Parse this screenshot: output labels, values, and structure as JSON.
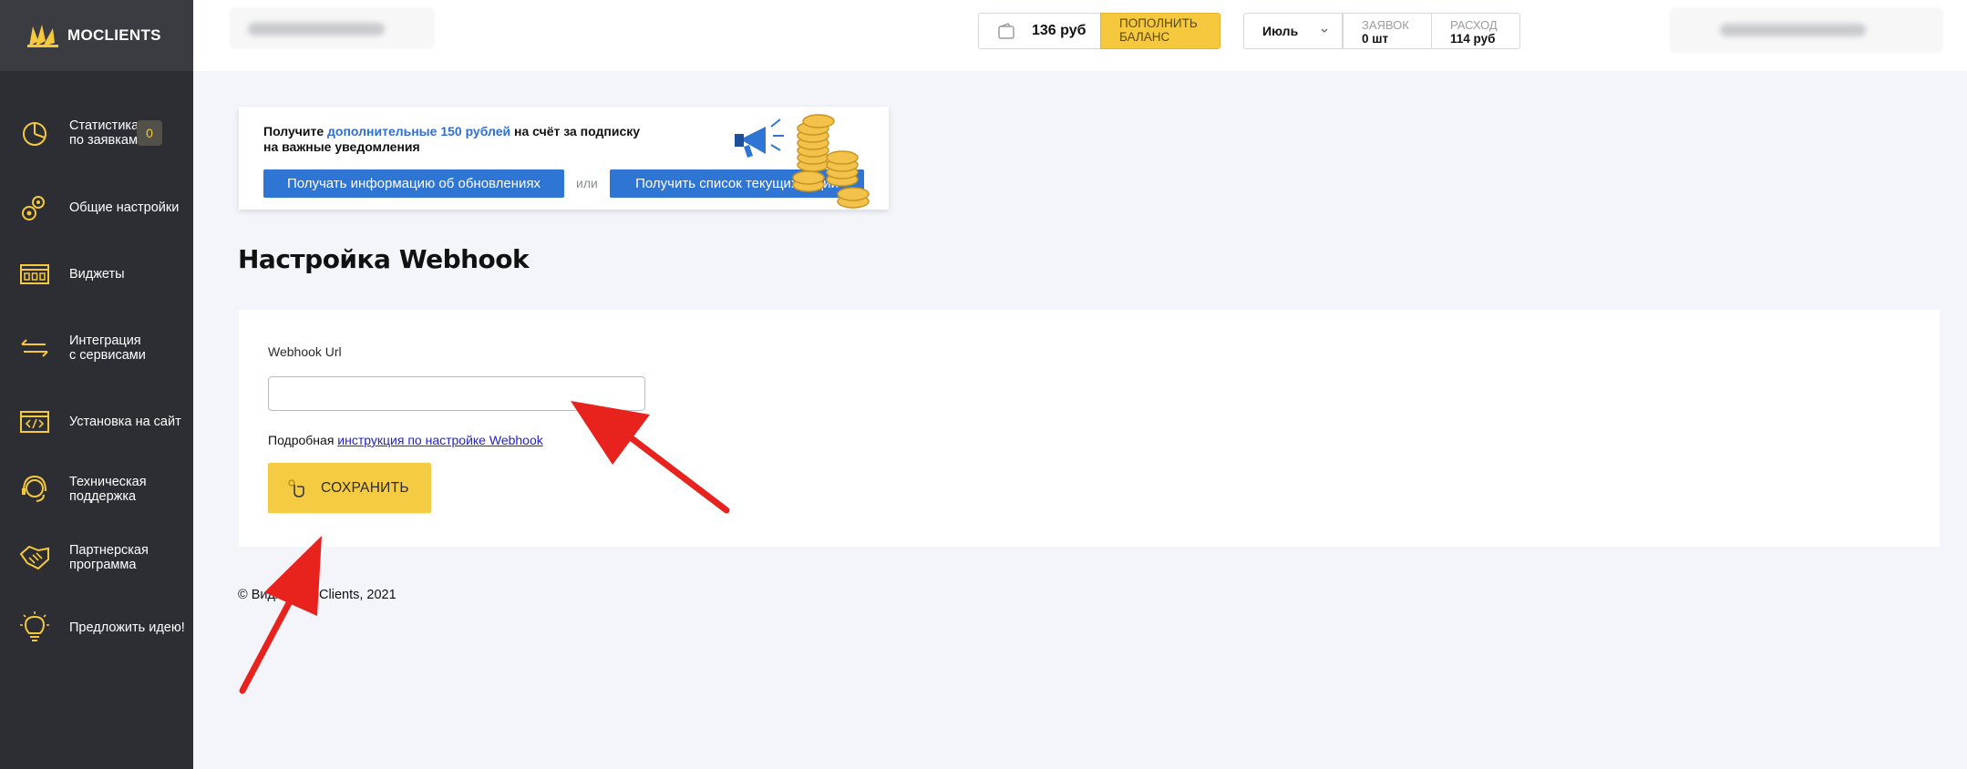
{
  "brand": {
    "name": "MOCLIENTS"
  },
  "sidebar": {
    "items": [
      {
        "label": "Статистика по заявкам",
        "icon": "pie-chart-icon",
        "badge": "0"
      },
      {
        "label": "Общие настройки",
        "icon": "gears-icon"
      },
      {
        "label": "Виджеты",
        "icon": "widgets-icon"
      },
      {
        "label": "Интеграция с сервисами",
        "icon": "arrows-exchange-icon"
      },
      {
        "label": "Установка на сайт",
        "icon": "code-window-icon"
      },
      {
        "label": "Техническая поддержка",
        "icon": "headset-icon"
      },
      {
        "label": "Партнерская программа",
        "icon": "handshake-icon"
      },
      {
        "label": "Предложить идею!",
        "icon": "lightbulb-icon"
      }
    ]
  },
  "topbar": {
    "balance": "136 руб",
    "topup_label": "ПОПОЛНИТЬ БАЛАНС",
    "month": "Июль",
    "stats": [
      {
        "title": "ЗАЯВОК",
        "value": "0 шт"
      },
      {
        "title": "РАСХОД",
        "value": "114 руб"
      }
    ]
  },
  "promo": {
    "text_before": "Получите ",
    "text_highlight": "дополнительные 150 рублей",
    "text_after": " на счёт за подписку на важные уведомления",
    "button_updates": "Получать информацию об обновлениях",
    "or": "или",
    "button_promos": "Получить список текущих акций"
  },
  "page": {
    "title": "Настройка Webhook",
    "field_label": "Webhook Url",
    "field_value": "",
    "help_prefix": "Подробная ",
    "help_link": "инструкция по настройке Webhook",
    "save_label": "СОХРАНИТЬ"
  },
  "footer": {
    "text": "© Виджет MoClients, 2021"
  },
  "colors": {
    "sidebar": "#2c2e33",
    "accent": "#f5c83d",
    "primary": "#2f75d3",
    "annotation": "#e8231e"
  }
}
